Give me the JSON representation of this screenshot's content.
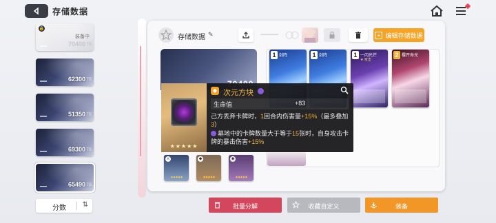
{
  "header": {
    "title": "存储数据"
  },
  "slots": [
    {
      "value": "70400",
      "unit": "TB",
      "status": "装备中",
      "locked": true
    },
    {
      "value": "62300",
      "unit": "TB"
    },
    {
      "value": "51350",
      "unit": "TB"
    },
    {
      "value": "69300",
      "unit": "TB"
    },
    {
      "value": "65490",
      "unit": "TB",
      "selected": true
    }
  ],
  "sort": {
    "label": "分数"
  },
  "deck": {
    "name": "存储数据",
    "edit_label": "编辑存储数据",
    "big_card_value": "70400"
  },
  "cards": [
    {
      "cost": "1",
      "name": "剑阵"
    },
    {
      "cost": "1",
      "name": "剑阵"
    },
    {
      "cost": "1",
      "name": "一闪光芒",
      "sub": "★ 攻击"
    },
    {
      "cost": "2",
      "name": "樱开命光"
    }
  ],
  "tooltip": {
    "quality": "紫",
    "title": "次元方块",
    "stars": "★★★★★",
    "stat_label": "生命值",
    "stat_value": "+83",
    "effect1_a": "己方丢弃卡牌时，",
    "effect1_hl1": "1",
    "effect1_b": "回合内伤害量",
    "effect1_hl2": "+15%",
    "effect1_c": "（最多叠加",
    "effect1_hl3": "3",
    "effect1_d": "）",
    "effect2_a": "墓地中的卡牌数量大于等于",
    "effect2_hl1": "15",
    "effect2_b": "张时，自身攻击卡牌的暴击伤害",
    "effect2_hl2": "+15%"
  },
  "items": [
    {
      "stars": "★★★★★",
      "badge": "⚔"
    },
    {
      "stars": "★★★★★",
      "badge": "◆"
    },
    {
      "stars": "★★★★★",
      "badge": "◉"
    }
  ],
  "buttons": {
    "dismantle": "批量分解",
    "collect": "收藏自定义",
    "equip": "装备"
  },
  "colors": {
    "accent_orange": "#f7a325",
    "dismantle_red": "#d4465c",
    "equip_orange": "#f29627",
    "tooltip_gold": "#f2b342"
  }
}
